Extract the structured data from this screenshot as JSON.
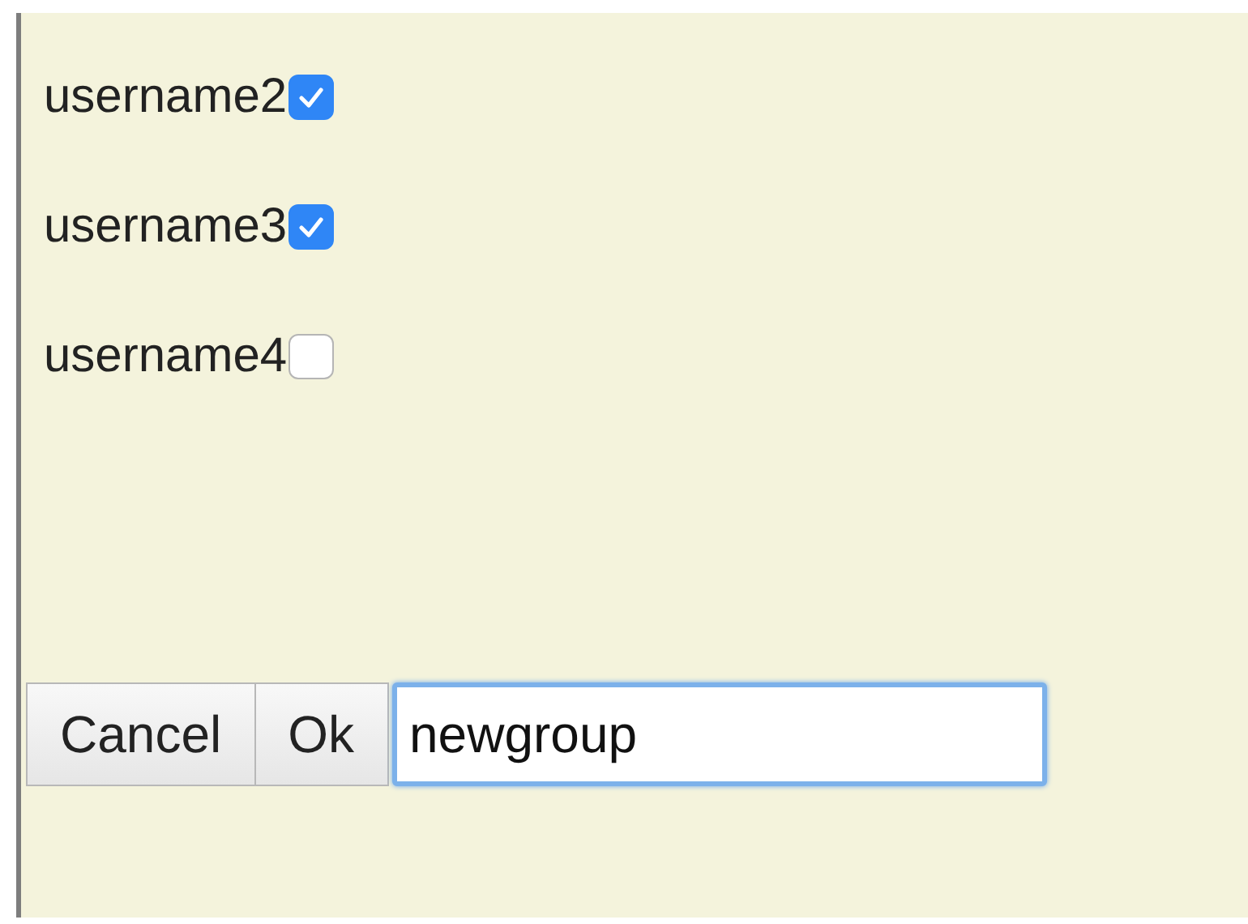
{
  "users": [
    {
      "name": "username2",
      "checked": true
    },
    {
      "name": "username3",
      "checked": true
    },
    {
      "name": "username4",
      "checked": false
    }
  ],
  "buttons": [
    {
      "label": "Cancel"
    },
    {
      "label": "Ok"
    }
  ],
  "group_field": {
    "value": "newgroup",
    "focused": true
  }
}
